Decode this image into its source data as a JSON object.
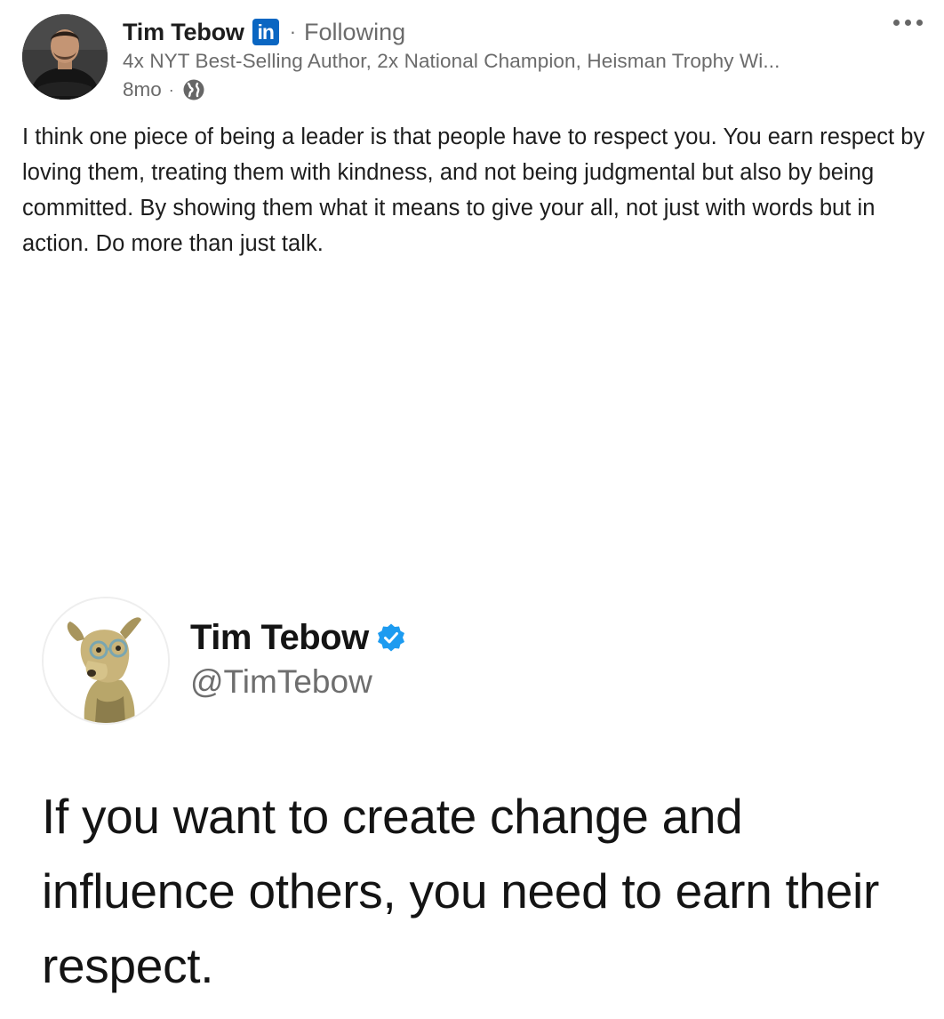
{
  "post": {
    "author": {
      "name": "Tim Tebow",
      "platform_badge": "in",
      "separator": "·",
      "follow_status": "Following",
      "headline": "4x NYT Best-Selling Author, 2x National Champion, Heisman Trophy Wi...",
      "age": "8mo",
      "meta_separator": "·",
      "visibility_icon": "globe-icon"
    },
    "more_icon": "ellipsis-icon",
    "text": "I think one piece of being a leader is that people have to respect you. You earn respect by loving them, treating them with kindness, and not being judgmental but also by being committed. By showing them what it means to give your all, not just with words but in action. Do more than just talk."
  },
  "embedded_tweet": {
    "name": "Tim Tebow",
    "verified_icon": "verified-badge-icon",
    "handle": "@TimTebow",
    "text": "If you want to create change and influence others, you need to earn their respect."
  },
  "colors": {
    "linkedin_blue": "#0a66c2",
    "verified_blue": "#1d9bf0",
    "secondary_text": "#6b6b6b",
    "primary_text": "#1d1d1d"
  }
}
